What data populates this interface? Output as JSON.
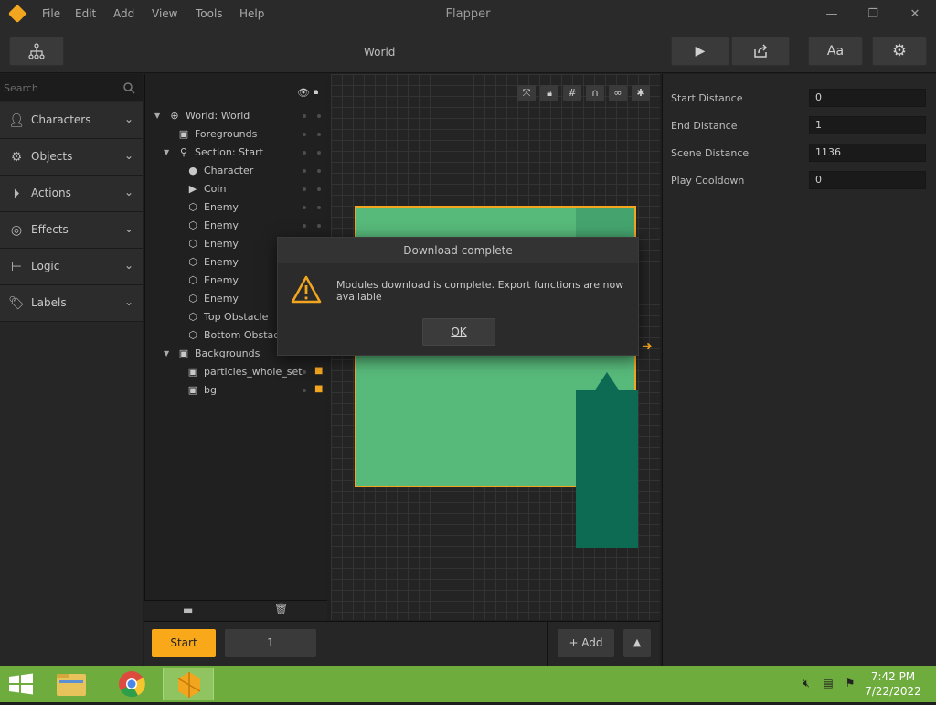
{
  "window": {
    "title": "Flapper",
    "menu": [
      "File",
      "Edit",
      "Add",
      "View",
      "Tools",
      "Help"
    ]
  },
  "toolbar": {
    "breadcrumb": "World",
    "font_button": "Aa"
  },
  "search": {
    "placeholder": "Search"
  },
  "categories": [
    {
      "label": "Characters",
      "icon": "person-icon"
    },
    {
      "label": "Objects",
      "icon": "gear-icon"
    },
    {
      "label": "Actions",
      "icon": "play-circle-icon"
    },
    {
      "label": "Effects",
      "icon": "spiral-icon"
    },
    {
      "label": "Logic",
      "icon": "logic-icon"
    },
    {
      "label": "Labels",
      "icon": "tag-icon"
    }
  ],
  "hierarchy": [
    {
      "label": "World: World",
      "icon": "globe-icon",
      "depth": 0,
      "expanded": true
    },
    {
      "label": "Foregrounds",
      "icon": "image-icon",
      "depth": 1
    },
    {
      "label": "Section: Start",
      "icon": "section-icon",
      "depth": 0,
      "expanded": true
    },
    {
      "label": "Character",
      "icon": "person-icon",
      "depth": 2
    },
    {
      "label": "Coin",
      "icon": "play-icon",
      "depth": 2
    },
    {
      "label": "Enemy",
      "icon": "hexagon-icon",
      "depth": 2
    },
    {
      "label": "Enemy",
      "icon": "hexagon-icon",
      "depth": 2
    },
    {
      "label": "Enemy",
      "icon": "hexagon-icon",
      "depth": 2
    },
    {
      "label": "Enemy",
      "icon": "hexagon-icon",
      "depth": 2
    },
    {
      "label": "Enemy",
      "icon": "hexagon-icon",
      "depth": 2
    },
    {
      "label": "Enemy",
      "icon": "hexagon-icon",
      "depth": 2
    },
    {
      "label": "Top Obstacle",
      "icon": "hexagon-icon",
      "depth": 2
    },
    {
      "label": "Bottom Obstacle",
      "icon": "hexagon-icon",
      "depth": 2
    },
    {
      "label": "Backgrounds",
      "icon": "image-icon",
      "depth": 0,
      "expanded": true
    },
    {
      "label": "particles_whole_set",
      "icon": "image-icon",
      "depth": 2,
      "locked": true
    },
    {
      "label": "bg",
      "icon": "image-icon",
      "depth": 2,
      "locked": true
    }
  ],
  "bottom": {
    "start_label": "Start",
    "section_number": "1",
    "add_label": "+ Add"
  },
  "properties": [
    {
      "label": "Start Distance",
      "value": "0"
    },
    {
      "label": "End Distance",
      "value": "1"
    },
    {
      "label": "Scene Distance",
      "value": "1136"
    },
    {
      "label": "Play Cooldown",
      "value": "0"
    }
  ],
  "dialog": {
    "title": "Download complete",
    "message": "Modules download is complete. Export functions are now available",
    "ok_label": "OK"
  },
  "taskbar": {
    "time": "7:42 PM",
    "date": "7/22/2022"
  },
  "colors": {
    "accent": "#f9a81a",
    "game_bg": "#57b97a",
    "pipe": "#0e6b53",
    "taskbar": "#6fac3e"
  }
}
